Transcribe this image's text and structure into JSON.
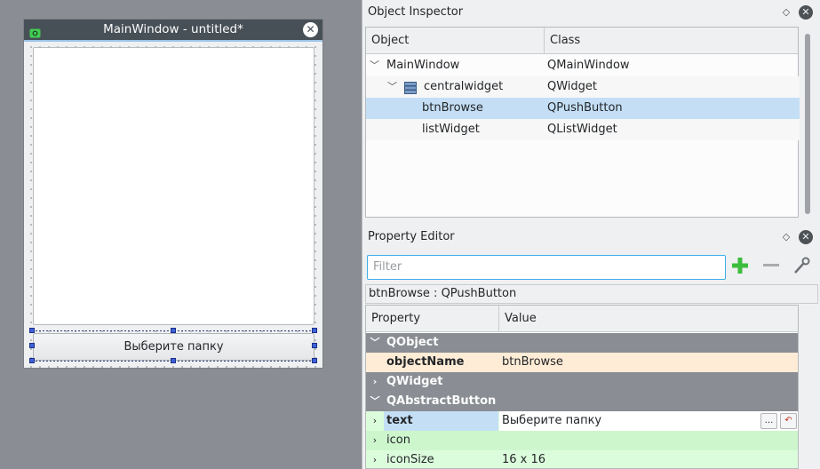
{
  "form": {
    "title": "MainWindow - untitled*",
    "button_text": "Выберите папку"
  },
  "object_inspector": {
    "title": "Object Inspector",
    "headers": {
      "object": "Object",
      "class": "Class"
    },
    "rows": [
      {
        "object": "MainWindow",
        "class": "QMainWindow"
      },
      {
        "object": "centralwidget",
        "class": "QWidget"
      },
      {
        "object": "btnBrowse",
        "class": "QPushButton"
      },
      {
        "object": "listWidget",
        "class": "QListWidget"
      }
    ]
  },
  "property_editor": {
    "title": "Property Editor",
    "filter_placeholder": "Filter",
    "object_label": "btnBrowse : QPushButton",
    "headers": {
      "property": "Property",
      "value": "Value"
    },
    "rows": [
      {
        "name": "QObject",
        "value": ""
      },
      {
        "name": "objectName",
        "value": "btnBrowse"
      },
      {
        "name": "QWidget",
        "value": ""
      },
      {
        "name": "QAbstractButton",
        "value": ""
      },
      {
        "name": "text",
        "value": "Выберите папку"
      },
      {
        "name": "icon",
        "value": ""
      },
      {
        "name": "iconSize",
        "value": "16 x 16"
      }
    ],
    "ellipsis": "..."
  },
  "colors": {
    "selection": "#c4dff5",
    "group_row": "#8a8d93",
    "focus_border": "#3daee9",
    "handle": "#3d62d8"
  },
  "icons": [
    "app-icon",
    "close-icon",
    "float-icon",
    "widget-icon",
    "expand-arrow-icon",
    "collapse-arrow-icon",
    "add-icon",
    "remove-icon",
    "configure-icon",
    "reset-icon"
  ]
}
